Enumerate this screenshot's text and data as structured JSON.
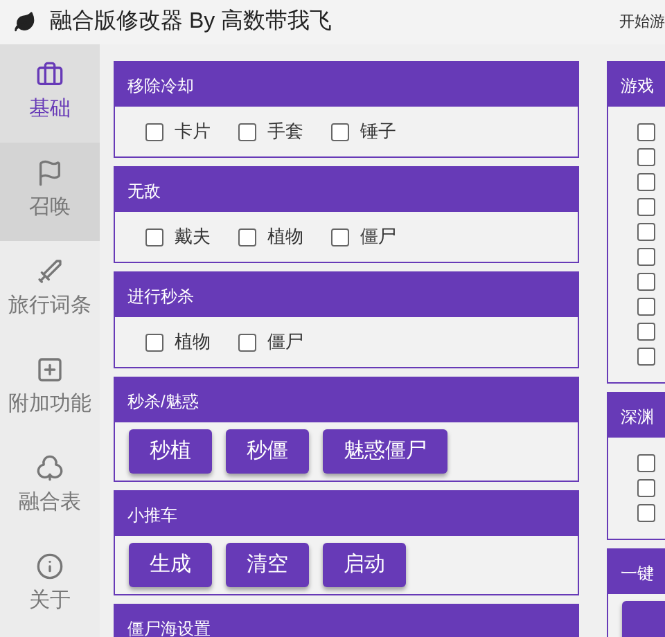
{
  "window": {
    "title": "融合版修改器 By 高数带我飞",
    "header_action": "开始游"
  },
  "sidebar": {
    "items": [
      {
        "label": "基础",
        "selected": true,
        "hovered": false
      },
      {
        "label": "召唤",
        "selected": false,
        "hovered": true
      },
      {
        "label": "旅行词条",
        "selected": false,
        "hovered": false
      },
      {
        "label": "附加功能",
        "selected": false,
        "hovered": false
      },
      {
        "label": "融合表",
        "selected": false,
        "hovered": false
      },
      {
        "label": "关于",
        "selected": false,
        "hovered": false
      }
    ]
  },
  "left_panels": [
    {
      "title": "移除冷却",
      "kind": "checkboxes",
      "items": [
        {
          "label": "卡片",
          "checked": false
        },
        {
          "label": "手套",
          "checked": false
        },
        {
          "label": "锤子",
          "checked": false
        }
      ]
    },
    {
      "title": "无敌",
      "kind": "checkboxes",
      "items": [
        {
          "label": "戴夫",
          "checked": false
        },
        {
          "label": "植物",
          "checked": false
        },
        {
          "label": "僵尸",
          "checked": false
        }
      ]
    },
    {
      "title": "进行秒杀",
      "kind": "checkboxes",
      "items": [
        {
          "label": "植物",
          "checked": false
        },
        {
          "label": "僵尸",
          "checked": false
        }
      ]
    },
    {
      "title": "秒杀/魅惑",
      "kind": "buttons",
      "items": [
        {
          "label": "秒植"
        },
        {
          "label": "秒僵"
        },
        {
          "label": "魅惑僵尸"
        }
      ]
    },
    {
      "title": "小推车",
      "kind": "buttons",
      "items": [
        {
          "label": "生成"
        },
        {
          "label": "清空"
        },
        {
          "label": "启动"
        }
      ]
    },
    {
      "title": "僵尸海设置",
      "kind": "empty"
    }
  ],
  "right_panels": [
    {
      "title": "游戏",
      "kind": "stack",
      "items": [
        {
          "checked": false
        },
        {
          "checked": false
        },
        {
          "checked": false
        },
        {
          "checked": false
        },
        {
          "checked": false
        },
        {
          "checked": false
        },
        {
          "checked": false
        },
        {
          "checked": false
        },
        {
          "checked": false
        },
        {
          "checked": false
        }
      ]
    },
    {
      "title": "深渊",
      "kind": "stack",
      "items": [
        {
          "checked": false
        },
        {
          "checked": false
        },
        {
          "checked": false
        }
      ]
    },
    {
      "title": "一键",
      "kind": "blank_button"
    }
  ]
}
